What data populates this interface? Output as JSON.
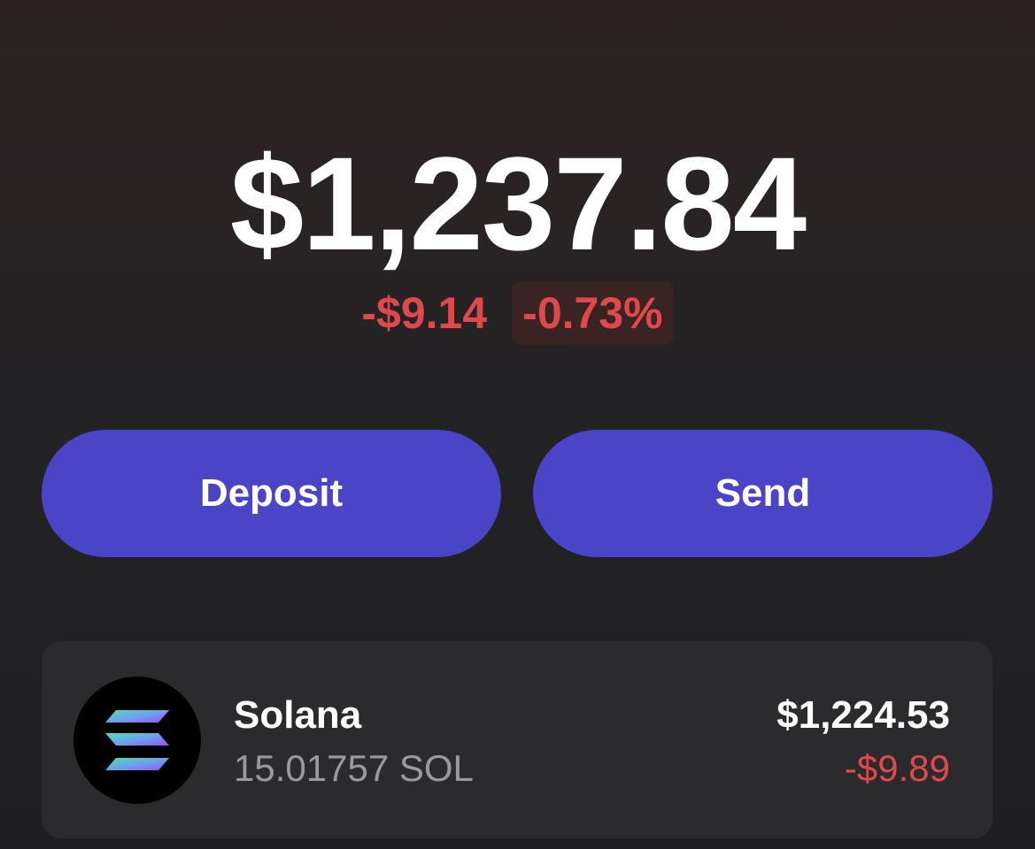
{
  "portfolio": {
    "balance": "$1,237.84",
    "change_amount": "-$9.14",
    "change_percent": "-0.73%",
    "change_color": "#e0494c"
  },
  "actions": {
    "deposit_label": "Deposit",
    "send_label": "Send",
    "button_color": "#4a44c6"
  },
  "tokens": [
    {
      "name": "Solana",
      "amount": "15.01757 SOL",
      "value": "$1,224.53",
      "change": "-$9.89",
      "icon": "solana-icon"
    }
  ]
}
